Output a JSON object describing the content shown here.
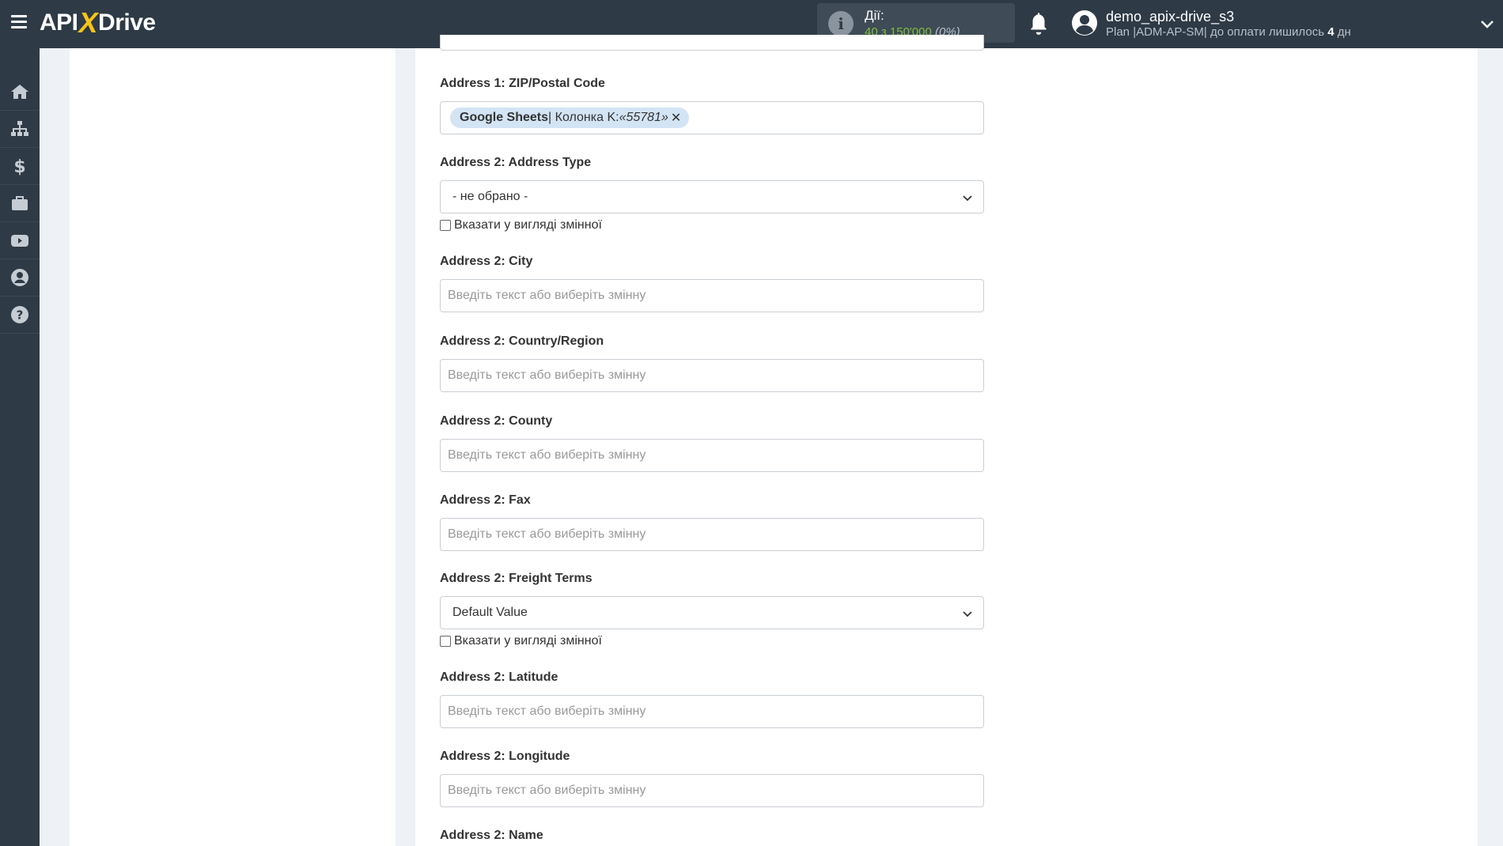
{
  "header": {
    "logo_api": "API",
    "logo_x": "X",
    "logo_drive": "Drive",
    "actions_label": "Дії:",
    "actions_count": "40 з 150'000",
    "actions_percent": "(0%)",
    "user_name": "demo_apix-drive_s3",
    "plan_prefix": "Plan |ADM-AP-SM| до оплати лишилось",
    "plan_days": "4",
    "plan_suffix": "дн"
  },
  "sidebar": {
    "items": [
      "home-icon",
      "sitemap-icon",
      "dollar-icon",
      "briefcase-icon",
      "youtube-icon",
      "user-icon",
      "help-icon"
    ]
  },
  "form": {
    "zip": {
      "label": "Address 1: ZIP/Postal Code",
      "tag_source": "Google Sheets",
      "tag_column": " | Колонка K: ",
      "tag_value": "«55781»",
      "tag_remove": "✕"
    },
    "address_type": {
      "label": "Address 2: Address Type",
      "value": "- не обрано -",
      "checkbox_label": "Вказати у вигляді змінної"
    },
    "city": {
      "label": "Address 2: City",
      "placeholder": "Введіть текст або виберіть змінну"
    },
    "country": {
      "label": "Address 2: Country/Region",
      "placeholder": "Введіть текст або виберіть змінну"
    },
    "county": {
      "label": "Address 2: County",
      "placeholder": "Введіть текст або виберіть змінну"
    },
    "fax": {
      "label": "Address 2: Fax",
      "placeholder": "Введіть текст або виберіть змінну"
    },
    "freight_terms": {
      "label": "Address 2: Freight Terms",
      "value": "Default Value",
      "checkbox_label": "Вказати у вигляді змінної"
    },
    "latitude": {
      "label": "Address 2: Latitude",
      "placeholder": "Введіть текст або виберіть змінну"
    },
    "longitude": {
      "label": "Address 2: Longitude",
      "placeholder": "Введіть текст або виберіть змінну"
    },
    "name": {
      "label": "Address 2: Name"
    }
  }
}
